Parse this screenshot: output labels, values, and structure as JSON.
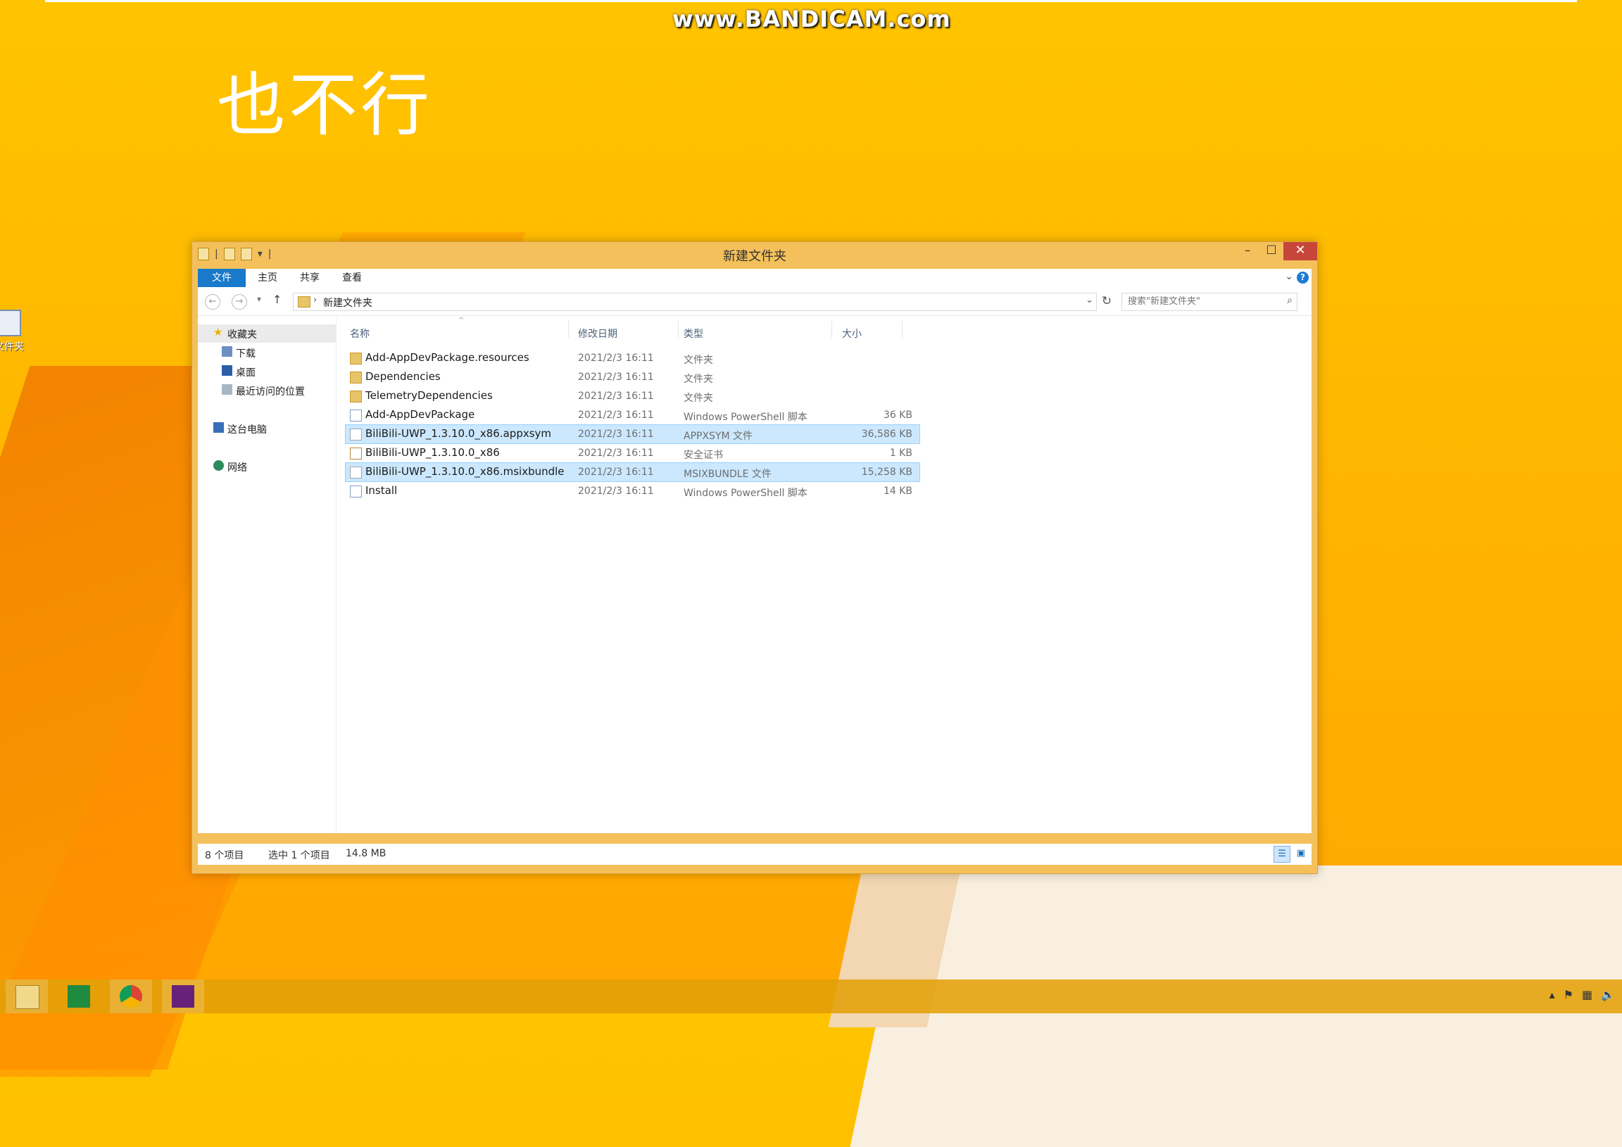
{
  "watermark": "www.BANDICAM.com",
  "overlay_caption": "也不行",
  "desktop_icon": {
    "label": "文件夹"
  },
  "window": {
    "title": "新建文件夹",
    "controls": {
      "minimize": "–",
      "maximize": "☐",
      "close": "✕"
    },
    "ribbon_tabs": [
      {
        "label": "文件",
        "active": true
      },
      {
        "label": "主页",
        "active": false
      },
      {
        "label": "共享",
        "active": false
      },
      {
        "label": "查看",
        "active": false
      }
    ],
    "address": {
      "path": "新建文件夹"
    },
    "search": {
      "placeholder": "搜索\"新建文件夹\""
    },
    "nav_pane": [
      {
        "label": "收藏夹",
        "icon": "star-icon"
      },
      {
        "label": "下载",
        "icon": "downloads-icon"
      },
      {
        "label": "桌面",
        "icon": "desktop-icon"
      },
      {
        "label": "最近访问的位置",
        "icon": "recent-places-icon"
      },
      {
        "label": "这台电脑",
        "icon": "computer-icon"
      },
      {
        "label": "网络",
        "icon": "network-icon"
      }
    ],
    "columns": {
      "name": "名称",
      "date": "修改日期",
      "type": "类型",
      "size": "大小"
    },
    "files": [
      {
        "name": "Add-AppDevPackage.resources",
        "date": "2021/2/3 16:11",
        "type": "文件夹",
        "size": "",
        "icon": "folder-icon",
        "selected": false
      },
      {
        "name": "Dependencies",
        "date": "2021/2/3 16:11",
        "type": "文件夹",
        "size": "",
        "icon": "folder-icon",
        "selected": false
      },
      {
        "name": "TelemetryDependencies",
        "date": "2021/2/3 16:11",
        "type": "文件夹",
        "size": "",
        "icon": "folder-icon",
        "selected": false
      },
      {
        "name": "Add-AppDevPackage",
        "date": "2021/2/3 16:11",
        "type": "Windows PowerShell 脚本",
        "size": "36 KB",
        "icon": "powershell-script-icon",
        "selected": false
      },
      {
        "name": "BiliBili-UWP_1.3.10.0_x86.appxsym",
        "date": "2021/2/3 16:11",
        "type": "APPXSYM 文件",
        "size": "36,586 KB",
        "icon": "file-icon",
        "selected": true
      },
      {
        "name": "BiliBili-UWP_1.3.10.0_x86",
        "date": "2021/2/3 16:11",
        "type": "安全证书",
        "size": "1 KB",
        "icon": "certificate-icon",
        "selected": false
      },
      {
        "name": "BiliBili-UWP_1.3.10.0_x86.msixbundle",
        "date": "2021/2/3 16:11",
        "type": "MSIXBUNDLE 文件",
        "size": "15,258 KB",
        "icon": "file-icon",
        "selected": true
      },
      {
        "name": "Install",
        "date": "2021/2/3 16:11",
        "type": "Windows PowerShell 脚本",
        "size": "14 KB",
        "icon": "powershell-script-icon",
        "selected": false
      }
    ],
    "status": {
      "count": "8 个项目",
      "selection": "选中 1 个项目",
      "size": "14.8 MB"
    }
  },
  "taskbar": {
    "items": [
      "file-explorer-icon",
      "store-icon",
      "chrome-icon",
      "visual-studio-icon"
    ]
  }
}
